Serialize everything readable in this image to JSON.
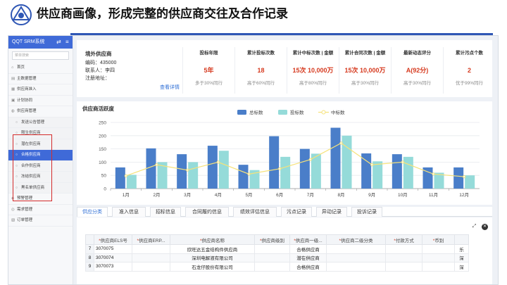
{
  "slide": {
    "title": "供应商画像，形成完整的供应商交往及合作记录"
  },
  "app": {
    "name": "QQT SRM系统",
    "search_placeholder": "菜单搜索",
    "header_icons": [
      "swap-icon",
      "menu-icon"
    ]
  },
  "sidebar": {
    "items": [
      {
        "label": "首页",
        "icon": "home-icon",
        "level": 1
      },
      {
        "label": "主数据管理",
        "icon": "database-icon",
        "level": 1
      },
      {
        "label": "供应商准入",
        "icon": "clipboard-icon",
        "level": 1
      },
      {
        "label": "计划协同",
        "icon": "calendar-icon",
        "level": 1
      },
      {
        "label": "供应商管理",
        "icon": "users-icon",
        "level": 1
      },
      {
        "label": "发送公告管理",
        "icon": "circle-icon",
        "level": 2
      },
      {
        "label": "限生供应商",
        "icon": "circle-icon",
        "level": 2
      },
      {
        "label": "潜在供应商",
        "icon": "circle-icon",
        "level": 2
      },
      {
        "label": "合格供应商",
        "icon": "circle-icon",
        "level": 2,
        "active": true
      },
      {
        "label": "合作供应商",
        "icon": "circle-icon",
        "level": 2
      },
      {
        "label": "冻结供应商",
        "icon": "circle-icon",
        "level": 2
      },
      {
        "label": "黑名单供应商",
        "icon": "circle-icon",
        "level": 2
      },
      {
        "label": "预警管理",
        "icon": "alert-icon",
        "level": 1
      },
      {
        "label": "需求管理",
        "icon": "requirement-icon",
        "level": 1
      },
      {
        "label": "订单管理",
        "icon": "order-icon",
        "level": 1
      }
    ]
  },
  "supplier": {
    "name": "境外供应商",
    "code_label": "编码：",
    "code": "435000",
    "contact_label": "联系人：",
    "contact": "李四",
    "address_label": "注册地址：",
    "address": "",
    "detail_link": "查看详情"
  },
  "metrics": [
    {
      "label": "投标年限",
      "value": "5年",
      "sub": "多于30%同行"
    },
    {
      "label": "累计投标次数",
      "value": "18",
      "sub": "高于60%同行"
    },
    {
      "label": "累计中标次数 | 金额",
      "value": "15次 10,000万",
      "sub": "高于80%同行"
    },
    {
      "label": "累计合同次数 | 金额",
      "value": "15次 10,000万",
      "sub": "高于30%同行"
    },
    {
      "label": "最新动态评分",
      "value": "A(92分)",
      "sub": "高于30%同行"
    },
    {
      "label": "累计污点个数",
      "value": "2",
      "sub": "优于99%同行"
    }
  ],
  "chart_data": {
    "type": "bar",
    "title": "供应商活跃度",
    "categories": [
      "1月",
      "2月",
      "3月",
      "4月",
      "5月",
      "6月",
      "7月",
      "8月",
      "9月",
      "10月",
      "11月",
      "12月"
    ],
    "series": [
      {
        "name": "总标数",
        "type": "bar",
        "color": "#4a7ec9",
        "values": [
          80,
          152,
          130,
          162,
          90,
          198,
          150,
          230,
          133,
          130,
          80,
          80
        ]
      },
      {
        "name": "投标数",
        "type": "bar",
        "color": "#95dbd9",
        "values": [
          52,
          100,
          100,
          143,
          70,
          120,
          132,
          200,
          103,
          120,
          60,
          50
        ]
      },
      {
        "name": "中标数",
        "type": "line",
        "color": "#f6e27a",
        "values": [
          48,
          90,
          70,
          100,
          55,
          75,
          110,
          172,
          90,
          100,
          55,
          45
        ]
      }
    ],
    "ylim": [
      0,
      250
    ],
    "yticks": [
      0,
      50,
      100,
      150,
      200,
      250
    ],
    "legend": "top-center",
    "grid": true
  },
  "tabs": [
    {
      "label": "供应分类",
      "active": true
    },
    {
      "label": "准入信息"
    },
    {
      "label": "招标信息"
    },
    {
      "label": "合同履约信息"
    },
    {
      "label": "绩效评估信息"
    },
    {
      "label": "污点记录"
    },
    {
      "label": "异动记录"
    },
    {
      "label": "投诉记录"
    }
  ],
  "grid": {
    "tools": [
      "expand-icon",
      "close-icon"
    ],
    "columns": [
      "供应商ELS号",
      "供应商ERP...",
      "供应商名称",
      "供应商级别",
      "供应商一级...",
      "供应商二级分类",
      "付款方式",
      "币别",
      ""
    ],
    "rows": [
      {
        "no": "7",
        "els": "3070075",
        "erp": "",
        "name": "欣旺达五金结构件供应商",
        "level": "",
        "cat1": "合格供应商",
        "cat2": "",
        "pay": "",
        "currency": "",
        "extra": "乐"
      },
      {
        "no": "8",
        "els": "3070074",
        "erp": "",
        "name": "深圳电解液有限公司",
        "level": "",
        "cat1": "潜在供应商",
        "cat2": "",
        "pay": "",
        "currency": "",
        "extra": "深"
      },
      {
        "no": "9",
        "els": "3070073",
        "erp": "",
        "name": "石龙仔股份有限公司",
        "level": "",
        "cat1": "合格供应商",
        "cat2": "",
        "pay": "",
        "currency": "",
        "extra": "深"
      }
    ]
  }
}
